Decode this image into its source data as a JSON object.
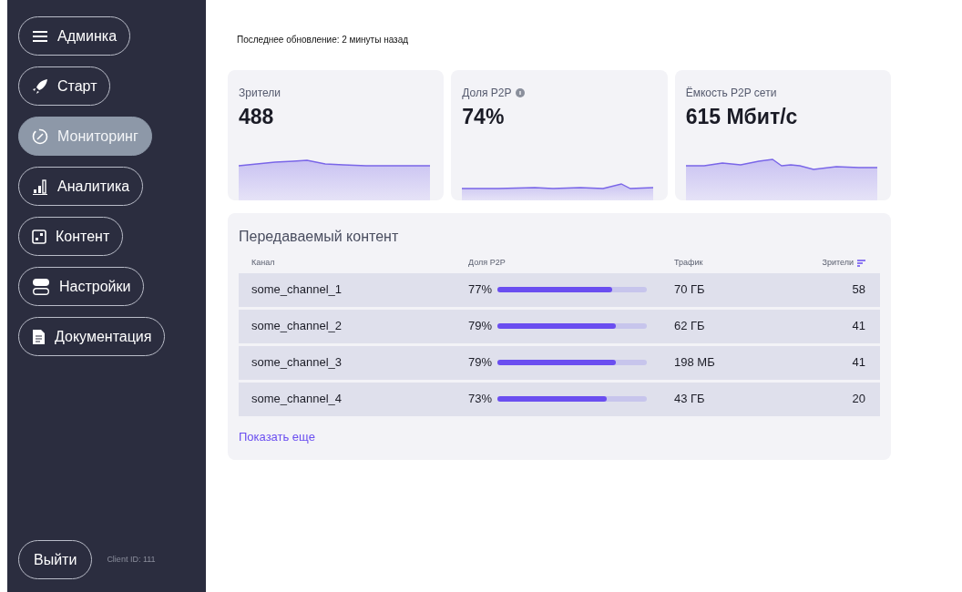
{
  "sidebar": {
    "items": [
      {
        "label": "Админка",
        "selected": false
      },
      {
        "label": "Старт",
        "selected": false
      },
      {
        "label": "Мониторинг",
        "selected": true
      },
      {
        "label": "Аналитика",
        "selected": false
      },
      {
        "label": "Контент",
        "selected": false
      },
      {
        "label": "Настройки",
        "selected": false
      },
      {
        "label": "Документация",
        "selected": false
      }
    ],
    "logout": "Выйти",
    "client_id": "Client ID: 111"
  },
  "last_update": "Последнее обновление: 2 минуты назад",
  "stats": [
    {
      "title": "Зрители",
      "value": "488",
      "info": false
    },
    {
      "title": "Доля P2P",
      "value": "74%",
      "info": true
    },
    {
      "title": "Ёмкость P2P сети",
      "value": "615 Мбит/с",
      "info": false
    }
  ],
  "table": {
    "title": "Передаваемый контент",
    "columns": [
      {
        "label": "Канал",
        "sorted": false
      },
      {
        "label": "Доля P2P",
        "sorted": false
      },
      {
        "label": "Трафик",
        "sorted": false
      },
      {
        "label": "Зрители",
        "sorted": true
      }
    ],
    "rows": [
      {
        "channel": "some_channel_1",
        "share": "77%",
        "level": 0.77,
        "traffic": "70 ГБ",
        "viewers": "58"
      },
      {
        "channel": "some_channel_2",
        "share": "79%",
        "level": 0.79,
        "traffic": "62 ГБ",
        "viewers": "41"
      },
      {
        "channel": "some_channel_3",
        "share": "79%",
        "level": 0.79,
        "traffic": "198 МБ",
        "viewers": "41"
      },
      {
        "channel": "some_channel_4",
        "share": "73%",
        "level": 0.73,
        "traffic": "43 ГБ",
        "viewers": "20"
      }
    ],
    "more": "Показать еще"
  }
}
